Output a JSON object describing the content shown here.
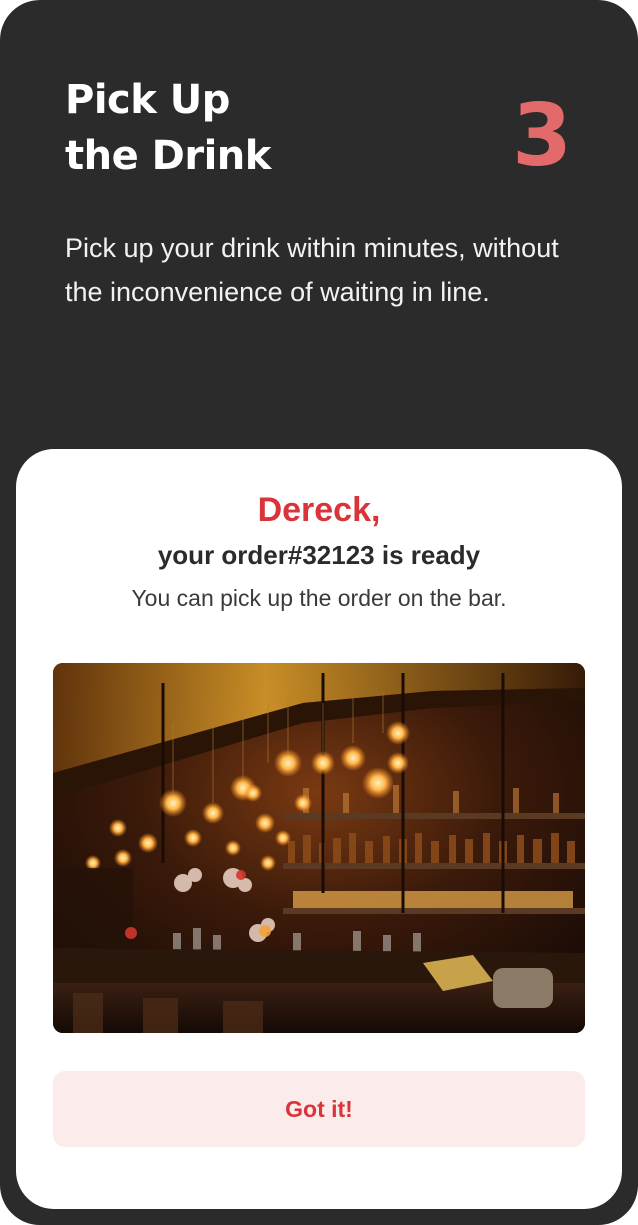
{
  "step": {
    "title_line1": "Pick Up",
    "title_line2": "the Drink",
    "number": "3",
    "description": "Pick up your drink within minutes, without the inconvenience of waiting in line."
  },
  "card": {
    "greeting": "Dereck,",
    "order_status": "your order#32123 is ready",
    "pickup_note": "You can pick up the order on the bar.",
    "image": "bar-interior-photo",
    "button_label": "Got it!"
  },
  "colors": {
    "background": "#2b2b2b",
    "accent": "#d8343a",
    "step_number": "#e36a6a",
    "button_background": "#fbeceb",
    "card": "#ffffff"
  }
}
